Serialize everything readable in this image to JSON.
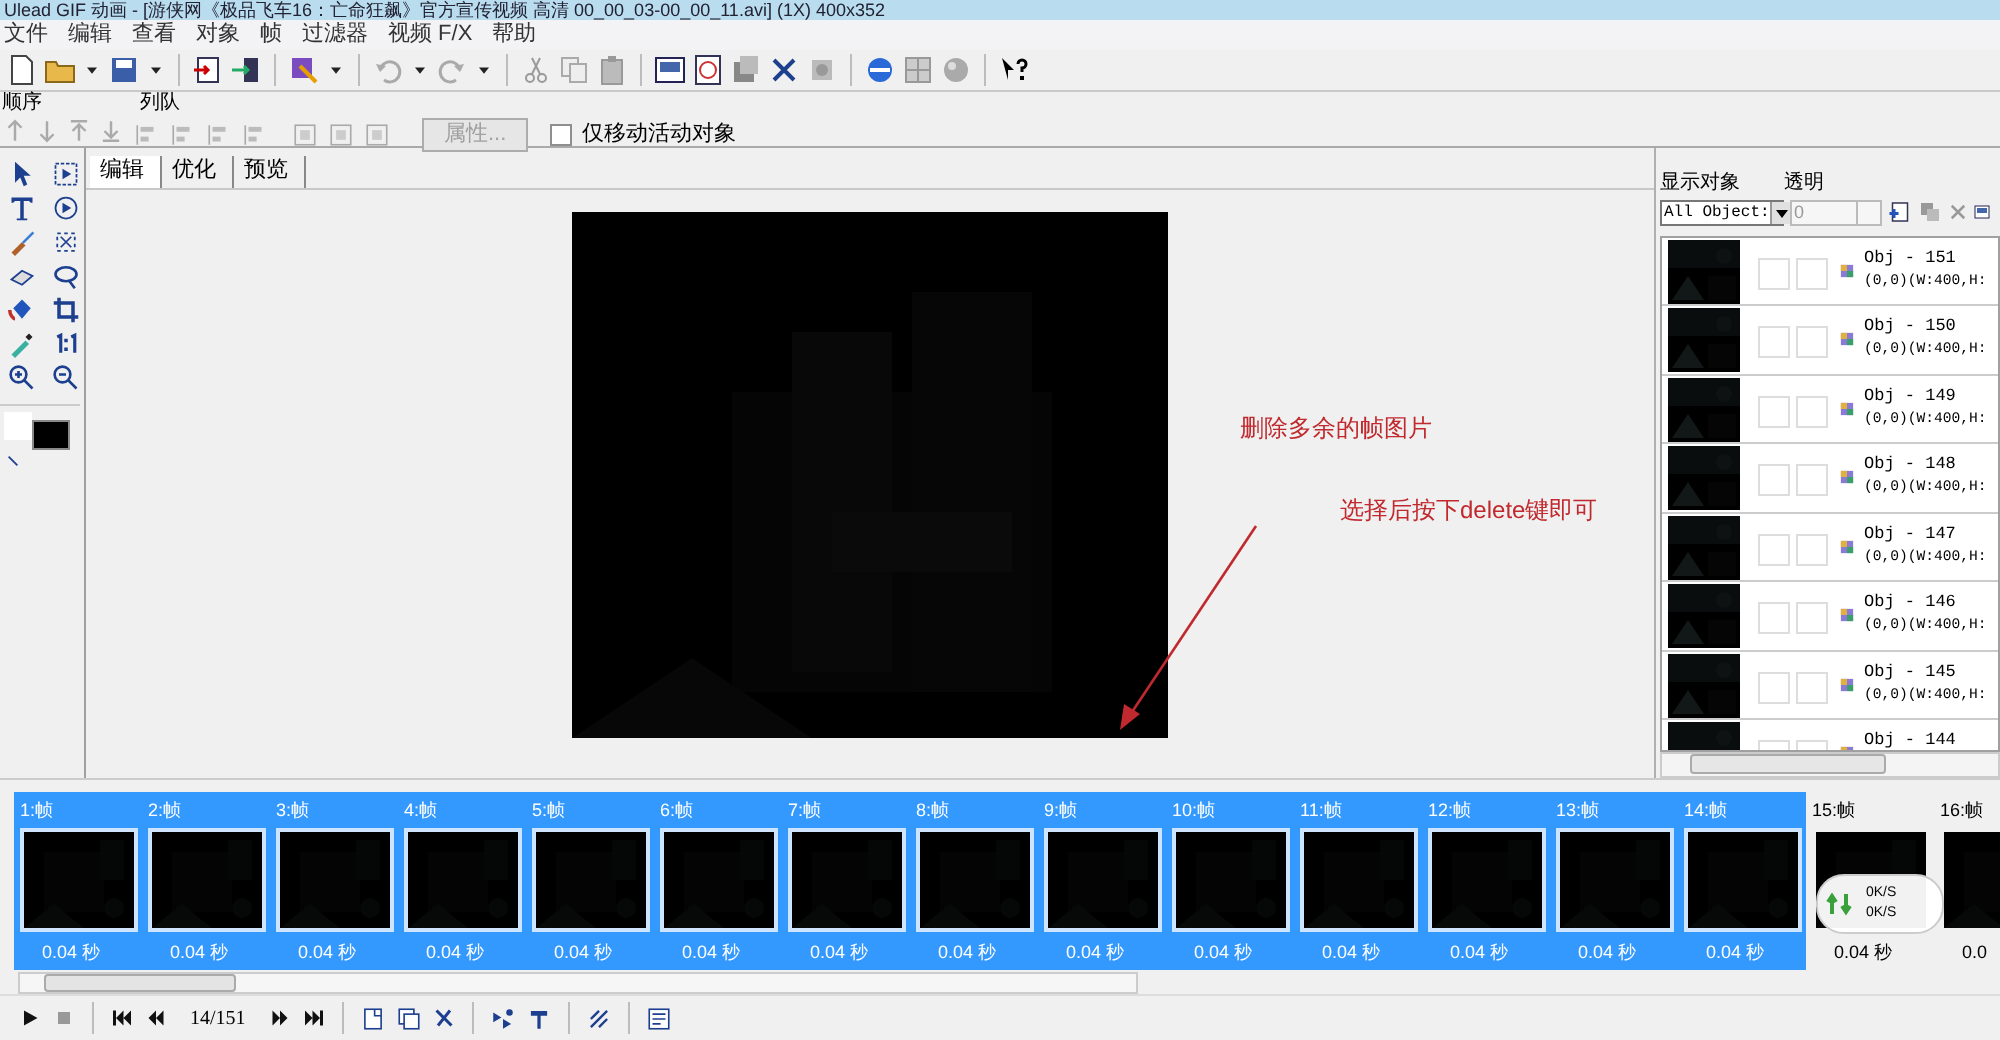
{
  "window": {
    "title": "Ulead GIF 动画 - [游侠网《极品飞车16：亡命狂飙》官方宣传视频 高清 00_00_03-00_00_11.avi] (1X) 400x352"
  },
  "menu": [
    "文件",
    "编辑",
    "查看",
    "对象",
    "帧",
    "过滤器",
    "视频 F/X",
    "帮助"
  ],
  "arrange_bar": {
    "order_label": "顺序",
    "queue_label": "列队",
    "properties_button": {
      "label": "属性...",
      "disabled": true
    },
    "move_active_only": {
      "label": "仅移动活动对象",
      "checked": false
    }
  },
  "tabs": [
    {
      "label": "编辑",
      "selected": true
    },
    {
      "label": "优化",
      "selected": false
    },
    {
      "label": "预览",
      "selected": false
    }
  ],
  "annotations": [
    {
      "text": "删除多余的帧图片"
    },
    {
      "text": "选择后按下delete键即可"
    }
  ],
  "object_panel": {
    "show_label": "显示对象",
    "opacity_label": "透明",
    "show_select": "All Object:",
    "opacity_value": "0",
    "objects": [
      {
        "name": "Obj - 151",
        "info": "(0,0)(W:400,H:"
      },
      {
        "name": "Obj - 150",
        "info": "(0,0)(W:400,H:"
      },
      {
        "name": "Obj - 149",
        "info": "(0,0)(W:400,H:"
      },
      {
        "name": "Obj - 148",
        "info": "(0,0)(W:400,H:"
      },
      {
        "name": "Obj - 147",
        "info": "(0,0)(W:400,H:"
      },
      {
        "name": "Obj - 146",
        "info": "(0,0)(W:400,H:"
      },
      {
        "name": "Obj - 145",
        "info": "(0,0)(W:400,H:"
      },
      {
        "name": "Obj - 144"
      }
    ]
  },
  "frames": [
    {
      "label": "1:帧",
      "duration": "0.04 秒",
      "selected": true
    },
    {
      "label": "2:帧",
      "duration": "0.04 秒",
      "selected": true
    },
    {
      "label": "3:帧",
      "duration": "0.04 秒",
      "selected": true
    },
    {
      "label": "4:帧",
      "duration": "0.04 秒",
      "selected": true
    },
    {
      "label": "5:帧",
      "duration": "0.04 秒",
      "selected": true
    },
    {
      "label": "6:帧",
      "duration": "0.04 秒",
      "selected": true
    },
    {
      "label": "7:帧",
      "duration": "0.04 秒",
      "selected": true
    },
    {
      "label": "8:帧",
      "duration": "0.04 秒",
      "selected": true
    },
    {
      "label": "9:帧",
      "duration": "0.04 秒",
      "selected": true
    },
    {
      "label": "10:帧",
      "duration": "0.04 秒",
      "selected": true
    },
    {
      "label": "11:帧",
      "duration": "0.04 秒",
      "selected": true
    },
    {
      "label": "12:帧",
      "duration": "0.04 秒",
      "selected": true
    },
    {
      "label": "13:帧",
      "duration": "0.04 秒",
      "selected": true
    },
    {
      "label": "14:帧",
      "duration": "0.04 秒",
      "selected": true
    },
    {
      "label": "15:帧",
      "duration": "0.04 秒",
      "selected": false
    },
    {
      "label": "16:帧",
      "duration": "0.0",
      "selected": false
    }
  ],
  "playback": {
    "position": "14/151"
  },
  "speed_widget": {
    "upload": "0K/S",
    "download": "0K/S"
  }
}
